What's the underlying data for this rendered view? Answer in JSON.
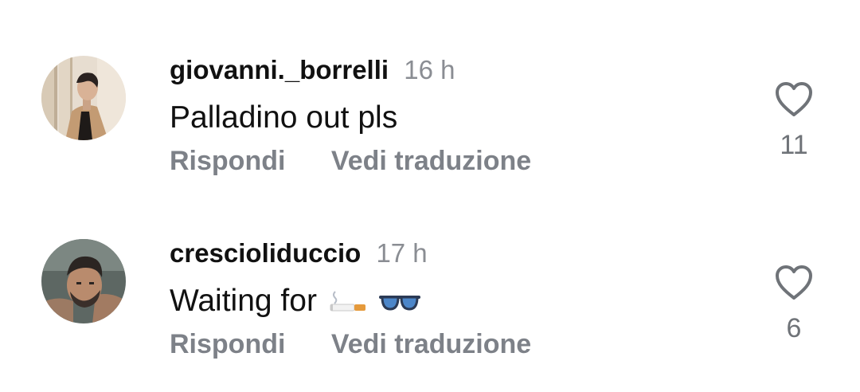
{
  "comments": [
    {
      "username": "giovanni._borrelli",
      "time": "16 h",
      "text": "Palladino out pls",
      "reply_label": "Rispondi",
      "translate_label": "Vedi traduzione",
      "likes": "11",
      "like_icon": "heart-outline-icon"
    },
    {
      "username": "crescioliduccio",
      "time": "17 h",
      "text": "Waiting for",
      "emojis": [
        "cigarette-emoji",
        "sunglasses-emoji"
      ],
      "reply_label": "Rispondi",
      "translate_label": "Vedi traduzione",
      "likes": "6",
      "like_icon": "heart-outline-icon"
    }
  ],
  "colors": {
    "text": "#111111",
    "muted": "#8a8d93",
    "action": "#7d8188"
  }
}
